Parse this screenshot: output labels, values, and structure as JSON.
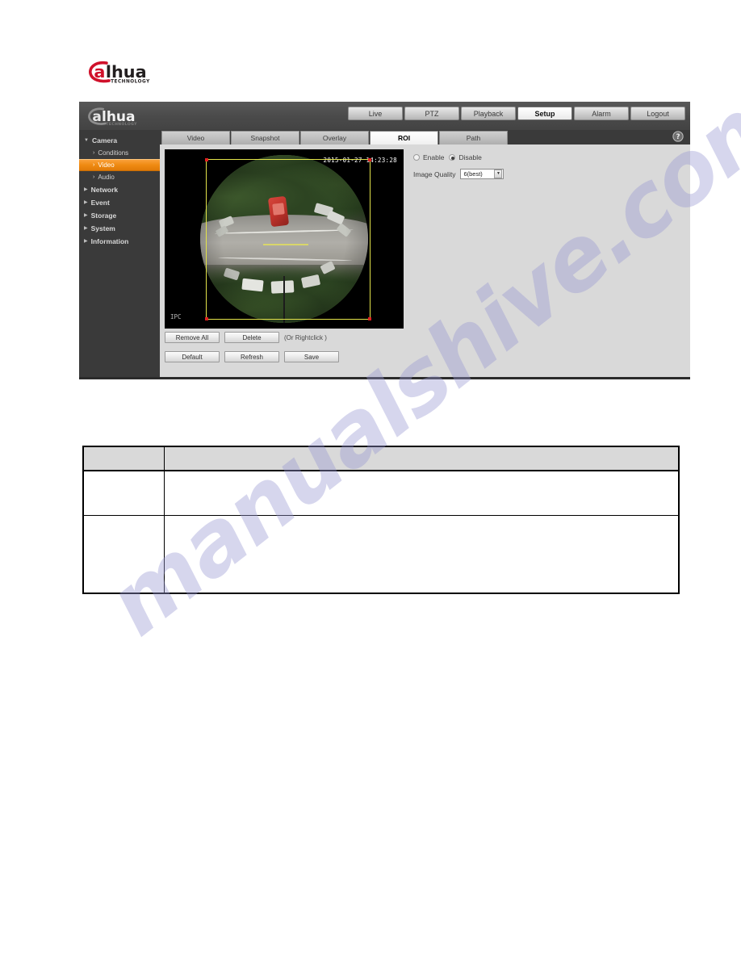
{
  "brand": {
    "logo_text": "alhua",
    "logo_sub": "TECHNOLOGY",
    "logo_icon": "dahua-logo-icon"
  },
  "app": {
    "header": {
      "logo_text": "alhua",
      "logo_sub": "TECHNOLOGY",
      "nav": [
        {
          "label": "Live",
          "active": false
        },
        {
          "label": "PTZ",
          "active": false
        },
        {
          "label": "Playback",
          "active": false
        },
        {
          "label": "Setup",
          "active": true
        },
        {
          "label": "Alarm",
          "active": false
        },
        {
          "label": "Logout",
          "active": false
        }
      ]
    },
    "sidebar": {
      "groups": [
        {
          "label": "Camera",
          "expanded": true,
          "triangle": "▼",
          "items": [
            {
              "label": "Conditions",
              "selected": false,
              "chevron": "›"
            },
            {
              "label": "Video",
              "selected": true,
              "chevron": "›"
            },
            {
              "label": "Audio",
              "selected": false,
              "chevron": "›"
            }
          ]
        },
        {
          "label": "Network",
          "expanded": false,
          "triangle": "▶",
          "items": []
        },
        {
          "label": "Event",
          "expanded": false,
          "triangle": "▶",
          "items": []
        },
        {
          "label": "Storage",
          "expanded": false,
          "triangle": "▶",
          "items": []
        },
        {
          "label": "System",
          "expanded": false,
          "triangle": "▶",
          "items": []
        },
        {
          "label": "Information",
          "expanded": false,
          "triangle": "▶",
          "items": []
        }
      ]
    },
    "tabs": [
      {
        "label": "Video",
        "active": false
      },
      {
        "label": "Snapshot",
        "active": false
      },
      {
        "label": "Overlay",
        "active": false
      },
      {
        "label": "ROI",
        "active": true
      },
      {
        "label": "Path",
        "active": false
      }
    ],
    "help_icon": "help-question-icon",
    "video_preview": {
      "osd_timestamp": "2015-01-27 14:23:28",
      "osd_channel": "IPC",
      "roi_overlay": {
        "border_color": "#e4e44a",
        "handle_color": "#e02020",
        "handles": 4
      }
    },
    "preview_buttons": [
      {
        "label": "Remove All"
      },
      {
        "label": "Delete"
      }
    ],
    "preview_hint": "(Or Rightclick )",
    "action_buttons": [
      {
        "label": "Default"
      },
      {
        "label": "Refresh"
      },
      {
        "label": "Save"
      }
    ],
    "settings": {
      "toggle": {
        "options": [
          {
            "label": "Enable",
            "selected": false
          },
          {
            "label": "Disable",
            "selected": true
          }
        ]
      },
      "image_quality": {
        "label": "Image Quality",
        "value": "6(best)",
        "arrow": "▼"
      }
    },
    "colors": {
      "sidebar_bg": "#3a3a3a",
      "header_bg": "#4b4b4b",
      "panel_bg": "#d9d9d9",
      "accent_selected": "#ef8a12",
      "tab_active_bg": "#ffffff"
    }
  },
  "doc_table": {
    "header": [
      "",
      ""
    ],
    "rows": [
      [
        "",
        ""
      ],
      [
        "",
        ""
      ]
    ]
  },
  "watermark": {
    "text": "manualshive.com",
    "color": "#9a9ad4"
  }
}
